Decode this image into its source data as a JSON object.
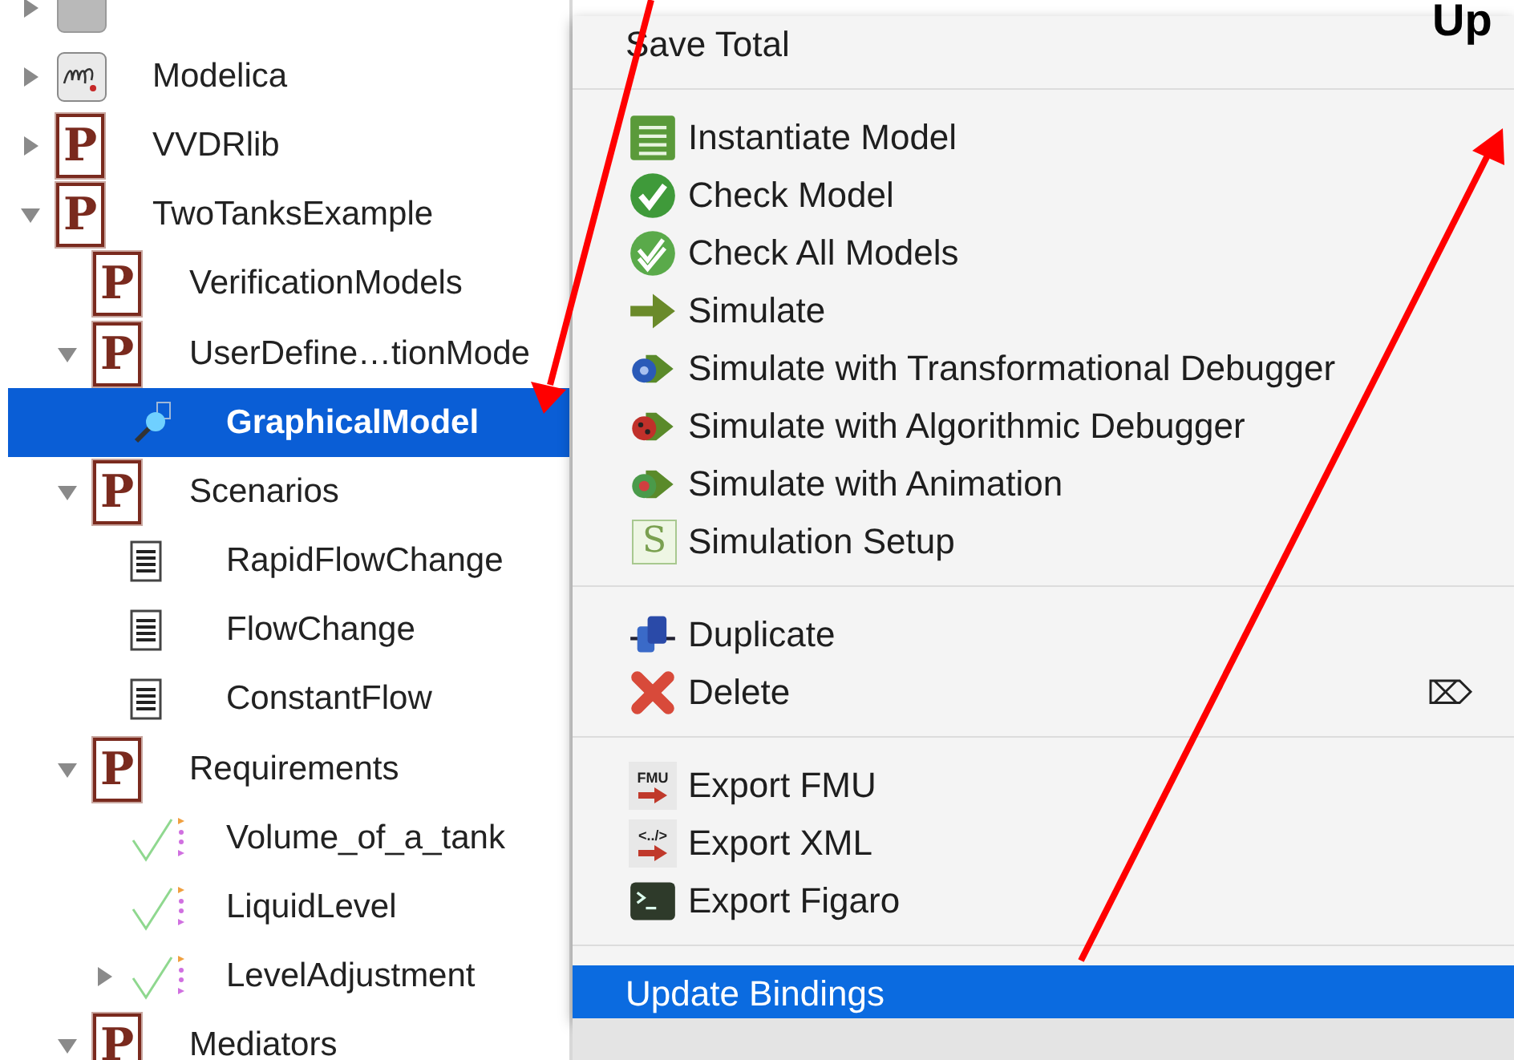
{
  "tree": {
    "items": [
      {
        "kind": "library",
        "expanded": false,
        "selected": false
      },
      {
        "label": "Modelica",
        "kind": "modelica",
        "expanded": false,
        "selected": false
      },
      {
        "label": "VVDRlib",
        "kind": "package",
        "badge": "P",
        "expanded": false,
        "selected": false
      },
      {
        "label": "TwoTanksExample",
        "kind": "package",
        "badge": "P",
        "expanded": true,
        "selected": false,
        "children": [
          {
            "label": "VerificationModels",
            "kind": "package",
            "badge": "P",
            "selected": false
          },
          {
            "label": "UserDefine…tionMode",
            "kind": "package",
            "badge": "P",
            "expanded": true,
            "selected": false,
            "children": [
              {
                "label": "GraphicalModel",
                "kind": "model",
                "selected": true
              }
            ]
          },
          {
            "label": "Scenarios",
            "kind": "package",
            "badge": "P",
            "expanded": true,
            "selected": false,
            "children": [
              {
                "label": "RapidFlowChange",
                "kind": "class",
                "selected": false
              },
              {
                "label": "FlowChange",
                "kind": "class",
                "selected": false
              },
              {
                "label": "ConstantFlow",
                "kind": "class",
                "selected": false
              }
            ]
          },
          {
            "label": "Requirements",
            "kind": "package",
            "badge": "P",
            "expanded": true,
            "selected": false,
            "children": [
              {
                "label": "Volume_of_a_tank",
                "kind": "requirement",
                "selected": false
              },
              {
                "label": "LiquidLevel",
                "kind": "requirement",
                "selected": false
              },
              {
                "label": "LevelAdjustment",
                "kind": "requirement",
                "expanded": false,
                "selected": false
              }
            ]
          },
          {
            "label": "Mediators",
            "kind": "package",
            "badge": "P",
            "expanded": true,
            "selected": false
          }
        ]
      }
    ]
  },
  "menu": {
    "groups": [
      [
        {
          "label": "Save Total",
          "kind": "plain",
          "selected": false
        }
      ],
      [
        {
          "label": "Instantiate Model",
          "kind": "instantiate",
          "selected": false
        },
        {
          "label": "Check Model",
          "kind": "check",
          "selected": false
        },
        {
          "label": "Check All Models",
          "kind": "check-all",
          "selected": false
        },
        {
          "label": "Simulate",
          "kind": "simulate",
          "selected": false
        },
        {
          "label": "Simulate with Transformational Debugger",
          "kind": "debug-transform",
          "selected": false
        },
        {
          "label": "Simulate with Algorithmic Debugger",
          "kind": "debug-algorithmic",
          "selected": false
        },
        {
          "label": "Simulate with Animation",
          "kind": "animate",
          "selected": false
        },
        {
          "label": "Simulation Setup",
          "kind": "setup",
          "badge": "S",
          "selected": false
        }
      ],
      [
        {
          "label": "Duplicate",
          "kind": "duplicate",
          "selected": false
        },
        {
          "label": "Delete",
          "kind": "delete",
          "shortcut": "⌦",
          "selected": false
        }
      ],
      [
        {
          "label": "Export FMU",
          "kind": "export",
          "badge": "FMU",
          "selected": false
        },
        {
          "label": "Export XML",
          "kind": "export",
          "badge": "<../>",
          "selected": false
        },
        {
          "label": "Export Figaro",
          "kind": "terminal",
          "selected": false
        }
      ],
      [
        {
          "label": "Update Bindings",
          "kind": "plain",
          "selected": true
        }
      ]
    ]
  },
  "annotation": {
    "text": "Up"
  }
}
